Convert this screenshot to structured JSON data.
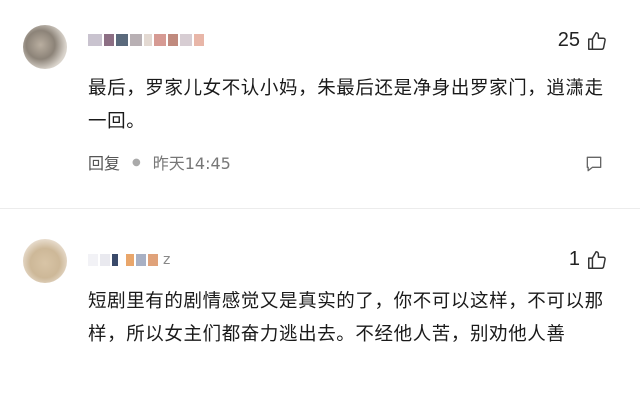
{
  "comments": [
    {
      "likes": "25",
      "text": "最后，罗家儿女不认小妈，朱最后还是净身出罗家门，逍潇走一回。",
      "reply_label": "回复",
      "time": "昨天14:45"
    },
    {
      "name_suffix": "z",
      "likes": "1",
      "text": "短剧里有的剧情感觉又是真实的了，你不可以这样，不可以那样，所以女主们都奋力逃出去。不经他人苦，别劝他人善"
    }
  ]
}
